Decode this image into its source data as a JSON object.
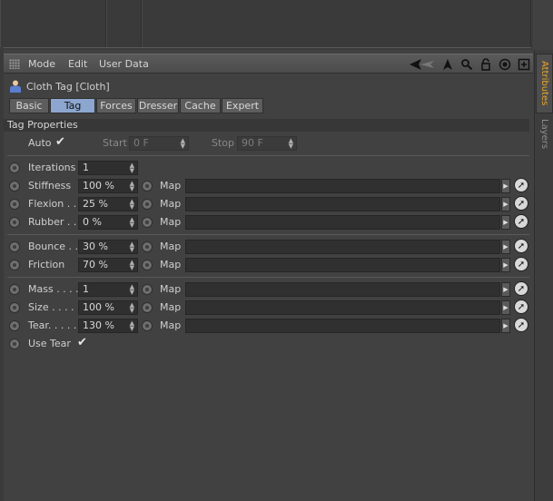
{
  "menubar": {
    "items": [
      "Mode",
      "Edit",
      "User Data"
    ],
    "icons": [
      "back-arrow-icon",
      "cursor-icon",
      "search-icon",
      "lock-icon",
      "target-icon",
      "new-window-icon"
    ]
  },
  "side_tabs": {
    "attributes": "Attributes",
    "layers": "Layers"
  },
  "object": {
    "title": "Cloth Tag [Cloth]"
  },
  "tabs": [
    "Basic",
    "Tag",
    "Forces",
    "Dresser",
    "Cache",
    "Expert"
  ],
  "active_tab": "Tag",
  "section": {
    "title": "Tag Properties"
  },
  "auto": {
    "label": "Auto",
    "checked": "✔",
    "start_label": "Start",
    "start_value": "0 F",
    "stop_label": "Stop",
    "stop_value": "90 F"
  },
  "params": {
    "iterations": {
      "label": "Iterations",
      "value": "1"
    },
    "stiffness": {
      "label": "Stiffness",
      "value": "100 %"
    },
    "flexion": {
      "label": "Flexion . .",
      "value": "25 %"
    },
    "rubber": {
      "label": "Rubber . .",
      "value": "0 %"
    },
    "bounce": {
      "label": "Bounce . .",
      "value": "30 %"
    },
    "friction": {
      "label": "Friction",
      "value": "70 %"
    },
    "mass": {
      "label": "Mass . . . .",
      "value": "1"
    },
    "size": {
      "label": "Size . . . . .",
      "value": "100 %"
    },
    "tear": {
      "label": "Tear. . . . .",
      "value": "130 %"
    },
    "use_tear": {
      "label": "Use Tear",
      "checked": "✔"
    }
  },
  "map_label": "Map",
  "colors": {
    "active_tab": "#8ca6cf",
    "accent_tab_text": "#e8a52a",
    "panel_bg": "#414141"
  }
}
